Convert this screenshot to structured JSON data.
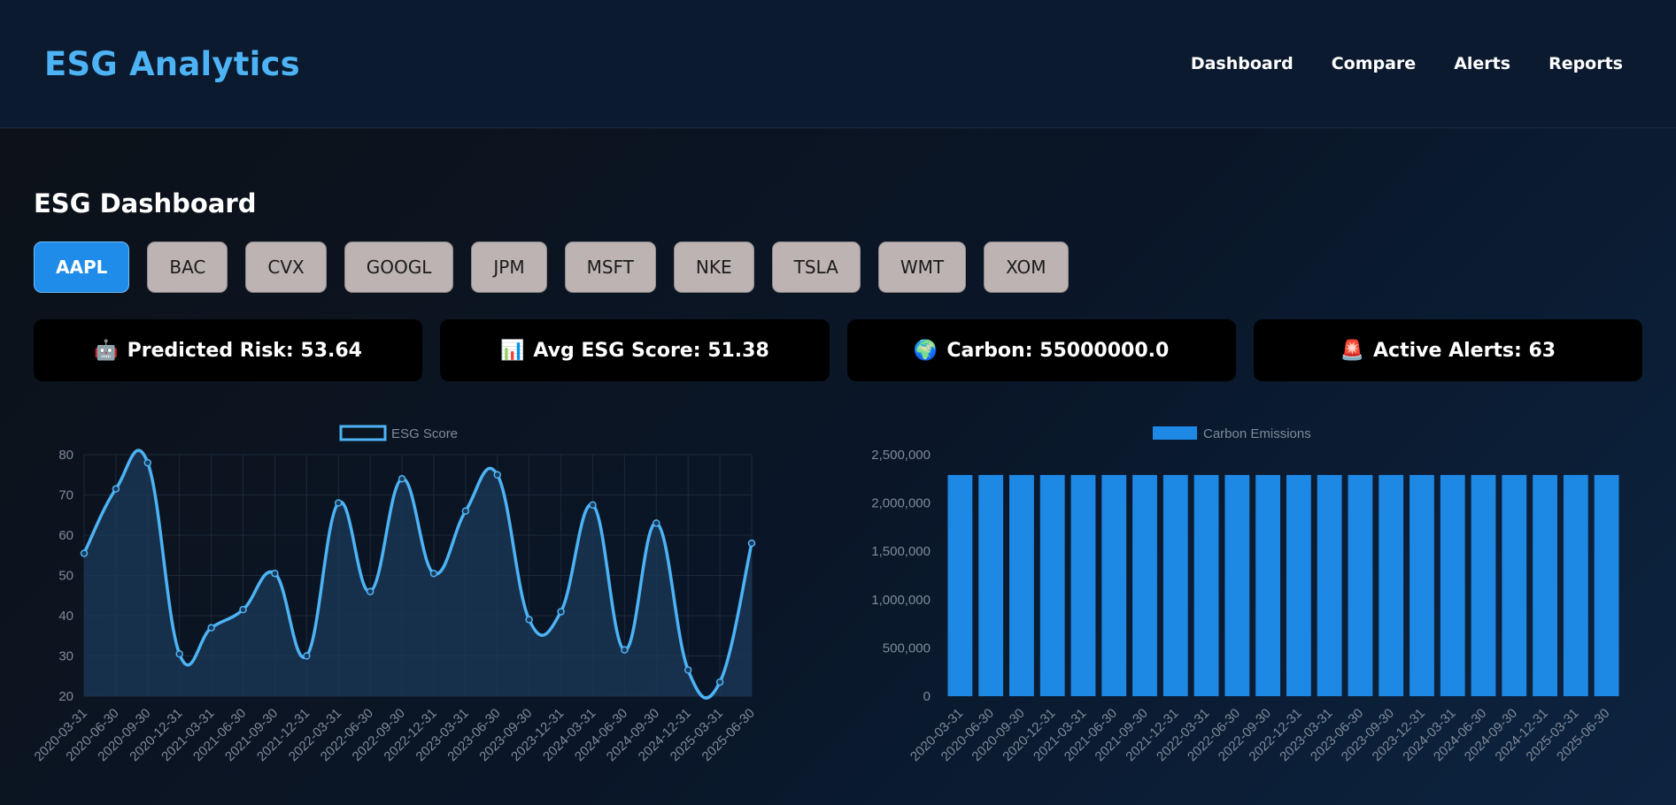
{
  "header": {
    "brand": "ESG Analytics",
    "nav": [
      "Dashboard",
      "Compare",
      "Alerts",
      "Reports"
    ]
  },
  "page": {
    "title": "ESG Dashboard",
    "tickers": [
      "AAPL",
      "BAC",
      "CVX",
      "GOOGL",
      "JPM",
      "MSFT",
      "NKE",
      "TSLA",
      "WMT",
      "XOM"
    ],
    "active_ticker": "AAPL"
  },
  "metrics": [
    {
      "icon": "robot-icon",
      "glyph": "🤖",
      "label": "Predicted Risk:",
      "value": "53.64"
    },
    {
      "icon": "bar-chart-icon",
      "glyph": "📊",
      "label": "Avg ESG Score:",
      "value": "51.38"
    },
    {
      "icon": "globe-icon",
      "glyph": "🌍",
      "label": "Carbon:",
      "value": "55000000.0"
    },
    {
      "icon": "siren-icon",
      "glyph": "🚨",
      "label": "Active Alerts:",
      "value": "63"
    }
  ],
  "colors": {
    "accent": "#4db3f5",
    "bar": "#1e88e5",
    "line": "#4db3f5",
    "line_fill": "#1b3a5a"
  },
  "chart_data": [
    {
      "type": "line",
      "legend": [
        "ESG Score"
      ],
      "legend_position": "top",
      "grid": true,
      "categories": [
        "2020-03-31",
        "2020-06-30",
        "2020-09-30",
        "2020-12-31",
        "2021-03-31",
        "2021-06-30",
        "2021-09-30",
        "2021-12-31",
        "2022-03-31",
        "2022-06-30",
        "2022-09-30",
        "2022-12-31",
        "2023-03-31",
        "2023-06-30",
        "2023-09-30",
        "2023-12-31",
        "2024-03-31",
        "2024-06-30",
        "2024-09-30",
        "2024-12-31",
        "2025-03-31",
        "2025-06-30"
      ],
      "series": [
        {
          "name": "ESG Score",
          "values": [
            55.5,
            71.5,
            78,
            30.5,
            37,
            41.5,
            50.5,
            30,
            68,
            46,
            74,
            50.5,
            66,
            75,
            39,
            41,
            67.5,
            31.5,
            63,
            26.5,
            23.5,
            58
          ]
        }
      ],
      "ylim": [
        20,
        80
      ],
      "yticks": [
        "20",
        "30",
        "40",
        "50",
        "60",
        "70",
        "80"
      ]
    },
    {
      "type": "bar",
      "legend": [
        "Carbon Emissions"
      ],
      "legend_position": "top",
      "grid": false,
      "categories": [
        "2020-03-31",
        "2020-06-30",
        "2020-09-30",
        "2020-12-31",
        "2021-03-31",
        "2021-06-30",
        "2021-09-30",
        "2021-12-31",
        "2022-03-31",
        "2022-06-30",
        "2022-09-30",
        "2022-12-31",
        "2023-03-31",
        "2023-06-30",
        "2023-09-30",
        "2023-12-31",
        "2024-03-31",
        "2024-06-30",
        "2024-09-30",
        "2024-12-31",
        "2025-03-31",
        "2025-06-30"
      ],
      "series": [
        {
          "name": "Carbon Emissions",
          "values": [
            2290000,
            2290000,
            2290000,
            2290000,
            2290000,
            2290000,
            2290000,
            2290000,
            2290000,
            2290000,
            2290000,
            2290000,
            2290000,
            2290000,
            2290000,
            2290000,
            2290000,
            2290000,
            2290000,
            2290000,
            2290000,
            2290000
          ]
        }
      ],
      "ylim": [
        0,
        2500000
      ],
      "yticks": [
        "0",
        "500,000",
        "1,000,000",
        "1,500,000",
        "2,000,000",
        "2,500,000"
      ]
    }
  ]
}
